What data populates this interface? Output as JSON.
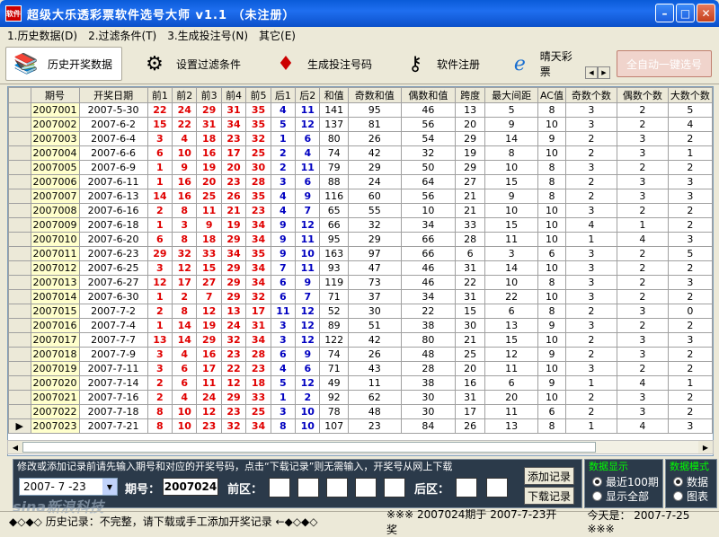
{
  "window": {
    "title": "超级大乐透彩票软件选号大师 v1.1  （未注册）",
    "icon_text": "软件"
  },
  "menu": [
    "1.历史数据(D)",
    "2.过滤条件(T)",
    "3.生成投注号(N)",
    "其它(E)"
  ],
  "toolbar": {
    "buttons": [
      {
        "label": "历史开奖数据",
        "icon": "books-icon"
      },
      {
        "label": "设置过滤条件",
        "icon": "gear-icon"
      },
      {
        "label": "生成投注号码",
        "icon": "ruby-icon"
      },
      {
        "label": "软件注册",
        "icon": "key-icon"
      },
      {
        "label": "晴天彩票",
        "icon": "browser-icon"
      }
    ],
    "auto_button": "全自动一键选号"
  },
  "table": {
    "headers": [
      "期号",
      "开奖日期",
      "前1",
      "前2",
      "前3",
      "前4",
      "前5",
      "后1",
      "后2",
      "和值",
      "奇数和值",
      "偶数和值",
      "跨度",
      "最大间距",
      "AC值",
      "奇数个数",
      "偶数个数",
      "大数个数"
    ],
    "rows": [
      [
        "2007001",
        "2007-5-30",
        "22",
        "24",
        "29",
        "31",
        "35",
        "4",
        "11",
        "141",
        "95",
        "46",
        "13",
        "5",
        "8",
        "3",
        "2",
        "5"
      ],
      [
        "2007002",
        "2007-6-2",
        "15",
        "22",
        "31",
        "34",
        "35",
        "5",
        "12",
        "137",
        "81",
        "56",
        "20",
        "9",
        "10",
        "3",
        "2",
        "4"
      ],
      [
        "2007003",
        "2007-6-4",
        "3",
        "4",
        "18",
        "23",
        "32",
        "1",
        "6",
        "80",
        "26",
        "54",
        "29",
        "14",
        "9",
        "2",
        "3",
        "2"
      ],
      [
        "2007004",
        "2007-6-6",
        "6",
        "10",
        "16",
        "17",
        "25",
        "2",
        "4",
        "74",
        "42",
        "32",
        "19",
        "8",
        "10",
        "2",
        "3",
        "1"
      ],
      [
        "2007005",
        "2007-6-9",
        "1",
        "9",
        "19",
        "20",
        "30",
        "2",
        "11",
        "79",
        "29",
        "50",
        "29",
        "10",
        "8",
        "3",
        "2",
        "2"
      ],
      [
        "2007006",
        "2007-6-11",
        "1",
        "16",
        "20",
        "23",
        "28",
        "3",
        "6",
        "88",
        "24",
        "64",
        "27",
        "15",
        "8",
        "2",
        "3",
        "3"
      ],
      [
        "2007007",
        "2007-6-13",
        "14",
        "16",
        "25",
        "26",
        "35",
        "4",
        "9",
        "116",
        "60",
        "56",
        "21",
        "9",
        "8",
        "2",
        "3",
        "3"
      ],
      [
        "2007008",
        "2007-6-16",
        "2",
        "8",
        "11",
        "21",
        "23",
        "4",
        "7",
        "65",
        "55",
        "10",
        "21",
        "10",
        "10",
        "3",
        "2",
        "2"
      ],
      [
        "2007009",
        "2007-6-18",
        "1",
        "3",
        "9",
        "19",
        "34",
        "9",
        "12",
        "66",
        "32",
        "34",
        "33",
        "15",
        "10",
        "4",
        "1",
        "2"
      ],
      [
        "2007010",
        "2007-6-20",
        "6",
        "8",
        "18",
        "29",
        "34",
        "9",
        "11",
        "95",
        "29",
        "66",
        "28",
        "11",
        "10",
        "1",
        "4",
        "3"
      ],
      [
        "2007011",
        "2007-6-23",
        "29",
        "32",
        "33",
        "34",
        "35",
        "9",
        "10",
        "163",
        "97",
        "66",
        "6",
        "3",
        "6",
        "3",
        "2",
        "5"
      ],
      [
        "2007012",
        "2007-6-25",
        "3",
        "12",
        "15",
        "29",
        "34",
        "7",
        "11",
        "93",
        "47",
        "46",
        "31",
        "14",
        "10",
        "3",
        "2",
        "2"
      ],
      [
        "2007013",
        "2007-6-27",
        "12",
        "17",
        "27",
        "29",
        "34",
        "6",
        "9",
        "119",
        "73",
        "46",
        "22",
        "10",
        "8",
        "3",
        "2",
        "3"
      ],
      [
        "2007014",
        "2007-6-30",
        "1",
        "2",
        "7",
        "29",
        "32",
        "6",
        "7",
        "71",
        "37",
        "34",
        "31",
        "22",
        "10",
        "3",
        "2",
        "2"
      ],
      [
        "2007015",
        "2007-7-2",
        "2",
        "8",
        "12",
        "13",
        "17",
        "11",
        "12",
        "52",
        "30",
        "22",
        "15",
        "6",
        "8",
        "2",
        "3",
        "0"
      ],
      [
        "2007016",
        "2007-7-4",
        "1",
        "14",
        "19",
        "24",
        "31",
        "3",
        "12",
        "89",
        "51",
        "38",
        "30",
        "13",
        "9",
        "3",
        "2",
        "2"
      ],
      [
        "2007017",
        "2007-7-7",
        "13",
        "14",
        "29",
        "32",
        "34",
        "3",
        "12",
        "122",
        "42",
        "80",
        "21",
        "15",
        "10",
        "2",
        "3",
        "3"
      ],
      [
        "2007018",
        "2007-7-9",
        "3",
        "4",
        "16",
        "23",
        "28",
        "6",
        "9",
        "74",
        "26",
        "48",
        "25",
        "12",
        "9",
        "2",
        "3",
        "2"
      ],
      [
        "2007019",
        "2007-7-11",
        "3",
        "6",
        "17",
        "22",
        "23",
        "4",
        "6",
        "71",
        "43",
        "28",
        "20",
        "11",
        "10",
        "3",
        "2",
        "2"
      ],
      [
        "2007020",
        "2007-7-14",
        "2",
        "6",
        "11",
        "12",
        "18",
        "5",
        "12",
        "49",
        "11",
        "38",
        "16",
        "6",
        "9",
        "1",
        "4",
        "1"
      ],
      [
        "2007021",
        "2007-7-16",
        "2",
        "4",
        "24",
        "29",
        "33",
        "1",
        "2",
        "92",
        "62",
        "30",
        "31",
        "20",
        "10",
        "2",
        "3",
        "2"
      ],
      [
        "2007022",
        "2007-7-18",
        "8",
        "10",
        "12",
        "23",
        "25",
        "3",
        "10",
        "78",
        "48",
        "30",
        "17",
        "11",
        "6",
        "2",
        "3",
        "2"
      ],
      [
        "2007023",
        "2007-7-21",
        "8",
        "10",
        "23",
        "32",
        "34",
        "8",
        "10",
        "107",
        "23",
        "84",
        "26",
        "13",
        "8",
        "1",
        "4",
        "3"
      ]
    ]
  },
  "entry": {
    "instruction": "修改或添加记录前请先输入期号和对应的开奖号码，点击“下载记录”则无需输入，开奖号从网上下载",
    "date": "2007- 7 -23",
    "issue_label": "期号：",
    "issue": "2007024",
    "front_label": "前区：",
    "back_label": "后区：",
    "add_btn": "添加记录",
    "download_btn": "下载记录"
  },
  "display": {
    "title": "数据显示",
    "options": [
      "最近100期",
      "显示全部"
    ],
    "selected": 0
  },
  "mode": {
    "title": "数据模式",
    "options": [
      "数据",
      "图表"
    ],
    "selected": 0
  },
  "status": {
    "left": "◆◇◆◇  历史记录：不完整，请下载或手工添加开奖记录  ←◆◇◆◇",
    "middle": "※※※  2007024期于 2007-7-23开奖",
    "today": "今天是： 2007-7-25  ※※※"
  },
  "watermark": "sina新浪科技"
}
